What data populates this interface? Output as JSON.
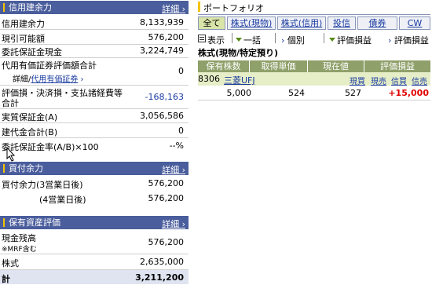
{
  "left": {
    "credit": {
      "title": "信用建余力",
      "detail": "詳細",
      "rows": [
        {
          "label": "信用建余力",
          "value": "8,133,939"
        },
        {
          "label": "現引可能額",
          "value": "576,200"
        },
        {
          "label": "委託保証金現金",
          "value": "3,224,749"
        },
        {
          "label": "代用有価証券評価額合計",
          "sub_prefix": "詳細/",
          "sub_link": "代用有価証券",
          "value": "0"
        },
        {
          "label": "評価損・決済損・支払諸経費等",
          "label2": "合計",
          "value": "-168,163"
        },
        {
          "label": "実質保証金(A)",
          "value": "3,056,586"
        },
        {
          "label": "建代金合計(B)",
          "value": "0"
        },
        {
          "label": "委託保証金率(A/B)×100",
          "value": "--%"
        }
      ]
    },
    "buying": {
      "title": "買付余力",
      "detail": "詳細",
      "rows": [
        {
          "label": "買付余力(3営業日後)",
          "value": "576,200"
        },
        {
          "label": "(4営業日後)",
          "value": "576,200"
        }
      ]
    },
    "assets": {
      "title": "保有資産評価",
      "detail": "詳細",
      "rows": [
        {
          "label": "現金残高",
          "label2": "※MRF含む",
          "value": "576,200"
        },
        {
          "label": "株式",
          "value": "2,635,000"
        },
        {
          "label": "計",
          "value": "3,211,200"
        }
      ]
    }
  },
  "right": {
    "title": "ポートフォリオ",
    "tabs": [
      "全て",
      "株式(現物)",
      "株式(信用)",
      "投信",
      "債券",
      "CW"
    ],
    "toolbar": {
      "display": "表示",
      "batch": "一括",
      "individual": "個別",
      "pl_display": "評価損益",
      "pl_detail": "評価損益"
    },
    "section_title": "株式(現物/特定預り)",
    "columns": [
      "保有株数",
      "取得単価",
      "現在値",
      "評価損益"
    ],
    "holding": {
      "code": "8306",
      "name": "三菱UFJ",
      "actions": [
        "現買",
        "現売",
        "信買",
        "信売"
      ],
      "shares": "5,000",
      "cost": "524",
      "price": "527",
      "pl": "+15,000"
    }
  },
  "colors": {
    "header_bg": "#4a5d9c",
    "accent_yellow": "#f4c400",
    "tab_active": "#d8e4a8",
    "table_header": "#8fa06a",
    "profit": "#e00000",
    "link": "#1a3ba0"
  }
}
